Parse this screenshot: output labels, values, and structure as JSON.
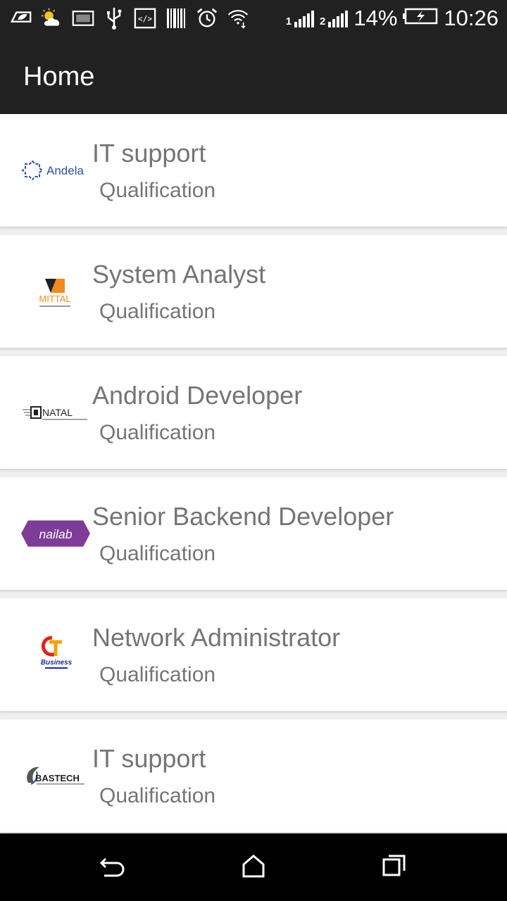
{
  "status_bar": {
    "icons": [
      "leaf-icon",
      "weather-icon",
      "image-icon",
      "usb-icon",
      "developer-icon",
      "barcode-icon",
      "alarm-icon",
      "wifi-icon"
    ],
    "sim1_label": "1",
    "sim2_label": "2",
    "battery_percent": "14%",
    "time": "10:26"
  },
  "app_bar": {
    "title": "Home"
  },
  "jobs": [
    {
      "title": "IT support",
      "subtitle": "Qualification",
      "logo": "andela-logo",
      "logo_text": "Andela"
    },
    {
      "title": "System Analyst",
      "subtitle": "Qualification",
      "logo": "mittal-logo",
      "logo_text": "MITTAL"
    },
    {
      "title": "Android Developer",
      "subtitle": "Qualification",
      "logo": "natal-logo",
      "logo_text": "NATAL"
    },
    {
      "title": "Senior Backend Developer",
      "subtitle": "Qualification",
      "logo": "nailab-logo",
      "logo_text": "nailab"
    },
    {
      "title": "Network Administrator",
      "subtitle": "Qualification",
      "logo": "business-logo",
      "logo_text": "Business"
    },
    {
      "title": "IT support",
      "subtitle": "Qualification",
      "logo": "bastech-logo",
      "logo_text": "BASTECH"
    }
  ],
  "nav_bar": {
    "buttons": [
      "back-icon",
      "home-icon",
      "recents-icon"
    ]
  }
}
